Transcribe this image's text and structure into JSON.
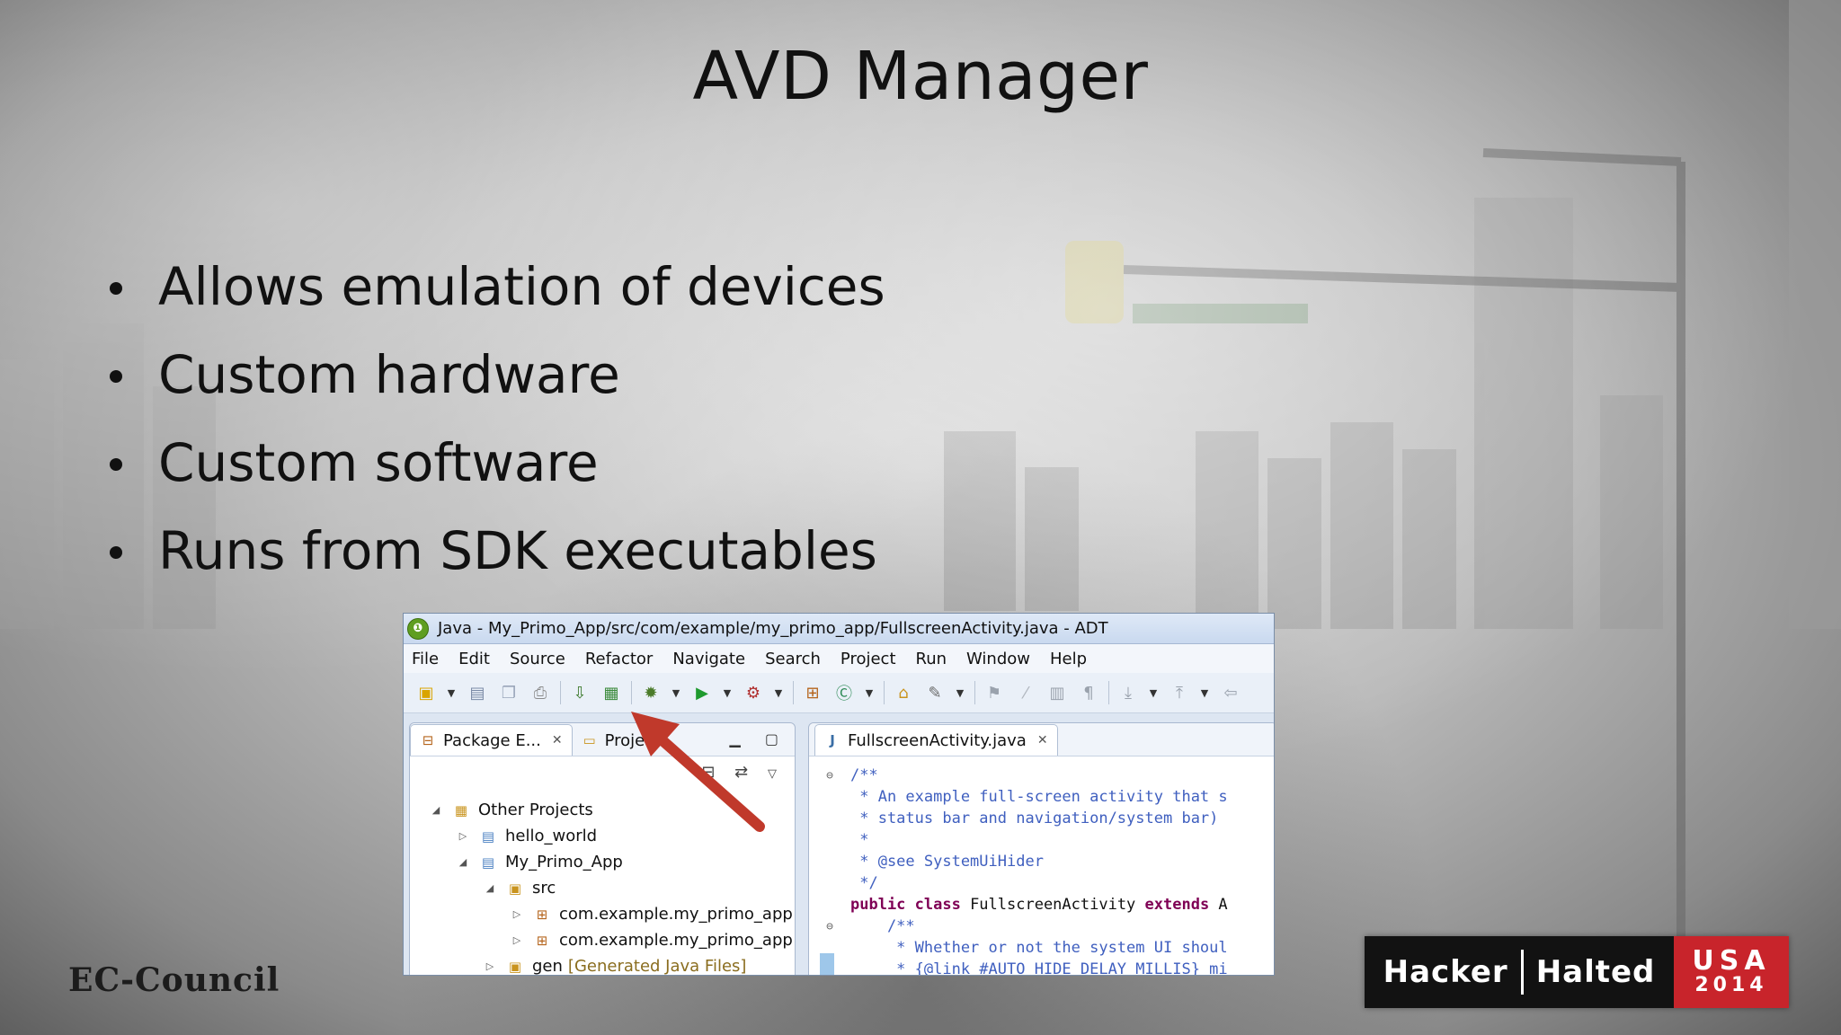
{
  "slide": {
    "title": "AVD Manager",
    "bullets": [
      "Allows emulation of devices",
      "Custom hardware",
      "Custom software",
      "Runs from SDK executables"
    ]
  },
  "adt": {
    "window_title": "Java - My_Primo_App/src/com/example/my_primo_app/FullscreenActivity.java - ADT",
    "menu": [
      "File",
      "Edit",
      "Source",
      "Refactor",
      "Navigate",
      "Search",
      "Project",
      "Run",
      "Window",
      "Help"
    ],
    "left_pane": {
      "tabs": [
        "Package E...",
        "Proje... "
      ],
      "tree": [
        {
          "label": "Other Projects",
          "note": ""
        },
        {
          "label": "hello_world",
          "note": ""
        },
        {
          "label": "My_Primo_App",
          "note": ""
        },
        {
          "label": "src",
          "note": ""
        },
        {
          "label": "com.example.my_primo_app",
          "note": ""
        },
        {
          "label": "com.example.my_primo_app",
          "note": ""
        },
        {
          "label": "gen",
          "note": "[Generated Java Files]"
        }
      ]
    },
    "editor": {
      "tab": "FullscreenActivity.java",
      "lines": [
        "/**",
        " * An example full-screen activity that s",
        " * status bar and navigation/system bar)",
        " *",
        " * @see SystemUiHider",
        " */",
        "public class",
        " FullscreenActivity ",
        "extends",
        " A",
        "    /**",
        "     * Whether or not the system UI shoul",
        "     * {@link #AUTO_HIDE_DELAY_MILLIS} mi"
      ]
    }
  },
  "branding": {
    "left_logo": "EC-Council",
    "right_logo_part1": "Hacker",
    "right_logo_part2": "Halted",
    "right_logo_country": "USA",
    "right_logo_year": "2014"
  },
  "colors": {
    "title_text": "#111111",
    "annotation_arrow": "#c0392b",
    "hh_red": "#c8242b",
    "code_comment": "#3f5fbf",
    "code_keyword": "#7f0055"
  },
  "icons": {
    "window": "adt-app-icon",
    "annotation": "red-arrow-pointer"
  }
}
